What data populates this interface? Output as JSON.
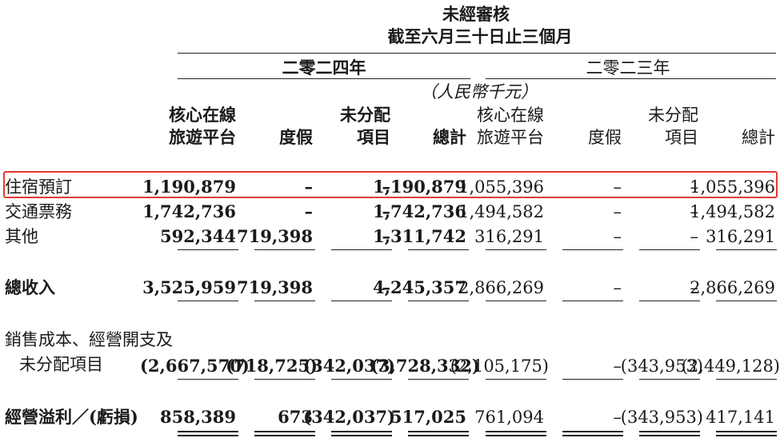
{
  "header": {
    "line1": "未經審核",
    "line2": "截至六月三十日止三個月",
    "unit": "（人民幣千元）",
    "year_2024": "二零二四年",
    "year_2023": "二零二三年"
  },
  "columns": {
    "c1_a": "核心在線",
    "c1_b": "旅遊平台",
    "c2": "度假",
    "c3_a": "未分配",
    "c3_b": "項目",
    "c4": "總計",
    "c5_a": "核心在線",
    "c5_b": "旅遊平台",
    "c6": "度假",
    "c7_a": "未分配",
    "c7_b": "項目",
    "c8": "總計"
  },
  "rows": {
    "accommodation": {
      "label": "住宿預訂",
      "values": [
        "1,190,879",
        "–",
        "–",
        "1,190,879",
        "1,055,396",
        "–",
        "–",
        "1,055,396"
      ]
    },
    "transport": {
      "label": "交通票務",
      "values": [
        "1,742,736",
        "–",
        "–",
        "1,742,736",
        "1,494,582",
        "–",
        "–",
        "1,494,582"
      ]
    },
    "others": {
      "label": "其他",
      "values": [
        "592,344",
        "719,398",
        "–",
        "1,311,742",
        "316,291",
        "–",
        "–",
        "316,291"
      ]
    },
    "total_revenue": {
      "label": "總收入",
      "values": [
        "3,525,959",
        "719,398",
        "–",
        "4,245,357",
        "2,866,269",
        "–",
        "–",
        "2,866,269"
      ]
    },
    "costs": {
      "label_line1": "銷售成本、經營開支及",
      "label_line2": "未分配項目",
      "values": [
        "(2,667,570)",
        "(718,725)",
        "(342,037)",
        "(3,728,332)",
        "(2,105,175)",
        "–",
        "(343,953)",
        "(2,449,128)"
      ]
    },
    "operating_profit": {
      "label": "經營溢利／(虧損)",
      "values": [
        "858,389",
        "673",
        "(342,037)",
        "517,025",
        "761,094",
        "–",
        "(343,953)",
        "417,141"
      ]
    }
  }
}
